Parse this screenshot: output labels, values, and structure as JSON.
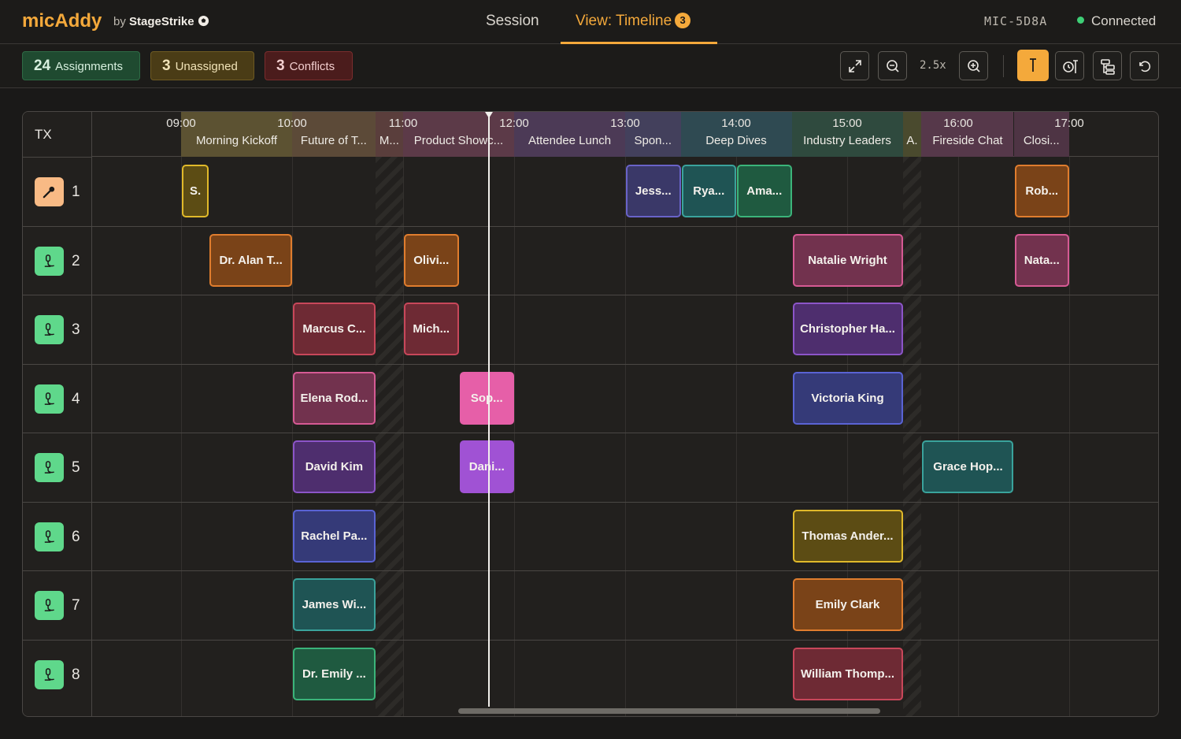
{
  "app": {
    "brand": "micAddy",
    "by_prefix": "by",
    "by_name": "StageStrike"
  },
  "nav": {
    "session": "Session",
    "view": "View: Timeline",
    "view_badge": "3"
  },
  "device": {
    "id": "MIC-5D8A",
    "status": "Connected",
    "status_color": "#3ecf76"
  },
  "summary": {
    "assignments_count": "24",
    "assignments_label": "Assignments",
    "unassigned_count": "3",
    "unassigned_label": "Unassigned",
    "conflicts_count": "3",
    "conflicts_label": "Conflicts"
  },
  "toolbar": {
    "zoom_level": "2.5x",
    "icons": [
      "expand-icon",
      "zoom-out-icon",
      "zoom-in-icon",
      "now-marker-icon",
      "clock-marker-icon",
      "layout-icon",
      "reset-icon"
    ]
  },
  "timeline": {
    "tx_header": "TX",
    "ticks": [
      "09:00",
      "10:00",
      "11:00",
      "12:00",
      "13:00",
      "14:00",
      "15:00",
      "16:00",
      "17:00"
    ],
    "segments": [
      {
        "name": "Morning Kickoff",
        "start": 9.0,
        "end": 10.0,
        "color": "#5c5232"
      },
      {
        "name": "Future of T...",
        "start": 10.0,
        "end": 10.75,
        "color": "#5c4a38"
      },
      {
        "name": "M...",
        "start": 10.75,
        "end": 11.0,
        "color": "#5a3e3c"
      },
      {
        "name": "Product Showc...",
        "start": 11.0,
        "end": 12.0,
        "color": "#5c3a48"
      },
      {
        "name": "Attendee Lunch",
        "start": 12.0,
        "end": 13.0,
        "color": "#4c3a56"
      },
      {
        "name": "Spon...",
        "start": 13.0,
        "end": 13.5,
        "color": "#43405c"
      },
      {
        "name": "Deep Dives",
        "start": 13.5,
        "end": 14.5,
        "color": "#2f4a52"
      },
      {
        "name": "Industry Leaders",
        "start": 14.5,
        "end": 15.5,
        "color": "#2f4a3e"
      },
      {
        "name": "A.",
        "start": 15.5,
        "end": 15.67,
        "color": "#4a4a2e"
      },
      {
        "name": "Fireside Chat",
        "start": 15.67,
        "end": 16.5,
        "color": "#56384a"
      },
      {
        "name": "Closi...",
        "start": 16.5,
        "end": 17.0,
        "color": "#4e3444"
      }
    ],
    "hatches": [
      [
        10.75,
        11.0
      ],
      [
        15.5,
        15.67
      ]
    ],
    "now": 11.77,
    "rows": [
      {
        "num": "1",
        "icon": "mic-handheld-icon",
        "active": true
      },
      {
        "num": "2",
        "icon": "mic-lavalier-icon",
        "active": false
      },
      {
        "num": "3",
        "icon": "mic-lavalier-icon",
        "active": false
      },
      {
        "num": "4",
        "icon": "mic-lavalier-icon",
        "active": false
      },
      {
        "num": "5",
        "icon": "mic-lavalier-icon",
        "active": false
      },
      {
        "num": "6",
        "icon": "mic-lavalier-icon",
        "active": false
      },
      {
        "num": "7",
        "icon": "mic-lavalier-icon",
        "active": false
      },
      {
        "num": "8",
        "icon": "mic-lavalier-icon",
        "active": false
      }
    ],
    "assignments": [
      {
        "row": 0,
        "start": 9.0,
        "end": 9.25,
        "label": "S.",
        "bg": "#5c4c14",
        "border": "#e0b92a"
      },
      {
        "row": 0,
        "start": 13.0,
        "end": 13.5,
        "label": "Jess...",
        "bg": "#3a3868",
        "border": "#6963c8"
      },
      {
        "row": 0,
        "start": 13.5,
        "end": 14.0,
        "label": "Rya...",
        "bg": "#1f5454",
        "border": "#3aa39c"
      },
      {
        "row": 0,
        "start": 14.0,
        "end": 14.5,
        "label": "Ama...",
        "bg": "#1f5a40",
        "border": "#3bb47a"
      },
      {
        "row": 0,
        "start": 16.5,
        "end": 17.0,
        "label": "Rob...",
        "bg": "#7a4318",
        "border": "#e07d2e"
      },
      {
        "row": 1,
        "start": 9.25,
        "end": 10.0,
        "label": "Dr. Alan T...",
        "bg": "#7a4318",
        "border": "#e07d2e"
      },
      {
        "row": 1,
        "start": 11.0,
        "end": 11.5,
        "label": "Olivi...",
        "bg": "#7a4318",
        "border": "#e07d2e"
      },
      {
        "row": 1,
        "start": 14.5,
        "end": 15.5,
        "label": "Natalie Wright",
        "bg": "#72324e",
        "border": "#d65a94"
      },
      {
        "row": 1,
        "start": 16.5,
        "end": 17.0,
        "label": "Nata...",
        "bg": "#72324e",
        "border": "#d65a94"
      },
      {
        "row": 2,
        "start": 10.0,
        "end": 10.75,
        "label": "Marcus C...",
        "bg": "#6e2a34",
        "border": "#c8475a"
      },
      {
        "row": 2,
        "start": 11.0,
        "end": 11.5,
        "label": "Mich...",
        "bg": "#6e2a34",
        "border": "#c8475a"
      },
      {
        "row": 2,
        "start": 14.5,
        "end": 15.5,
        "label": "Christopher Ha...",
        "bg": "#4e2e6e",
        "border": "#8c55c8"
      },
      {
        "row": 3,
        "start": 10.0,
        "end": 10.75,
        "label": "Elena Rod...",
        "bg": "#72324e",
        "border": "#d65a94"
      },
      {
        "row": 3,
        "start": 11.5,
        "end": 12.0,
        "label": "Sop...",
        "bg": "#e65fa8",
        "border": "#e65fa8"
      },
      {
        "row": 3,
        "start": 14.5,
        "end": 15.5,
        "label": "Victoria King",
        "bg": "#353a78",
        "border": "#5a63d4"
      },
      {
        "row": 4,
        "start": 10.0,
        "end": 10.75,
        "label": "David Kim",
        "bg": "#4e2e6e",
        "border": "#8c55c8"
      },
      {
        "row": 4,
        "start": 11.5,
        "end": 12.0,
        "label": "Dani...",
        "bg": "#a052d4",
        "border": "#a052d4"
      },
      {
        "row": 4,
        "start": 15.67,
        "end": 16.5,
        "label": "Grace Hop...",
        "bg": "#1f5454",
        "border": "#3aa39c"
      },
      {
        "row": 5,
        "start": 10.0,
        "end": 10.75,
        "label": "Rachel Pa...",
        "bg": "#353a78",
        "border": "#5a63d4"
      },
      {
        "row": 5,
        "start": 14.5,
        "end": 15.5,
        "label": "Thomas Ander...",
        "bg": "#5c4c14",
        "border": "#e0b92a"
      },
      {
        "row": 6,
        "start": 10.0,
        "end": 10.75,
        "label": "James Wi...",
        "bg": "#1f5454",
        "border": "#3aa39c"
      },
      {
        "row": 6,
        "start": 14.5,
        "end": 15.5,
        "label": "Emily Clark",
        "bg": "#7a4318",
        "border": "#e07d2e"
      },
      {
        "row": 7,
        "start": 10.0,
        "end": 10.75,
        "label": "Dr. Emily ...",
        "bg": "#1f5a40",
        "border": "#3bb47a"
      },
      {
        "row": 7,
        "start": 14.5,
        "end": 15.5,
        "label": "William Thomp...",
        "bg": "#6e2a34",
        "border": "#c8475a"
      }
    ]
  }
}
